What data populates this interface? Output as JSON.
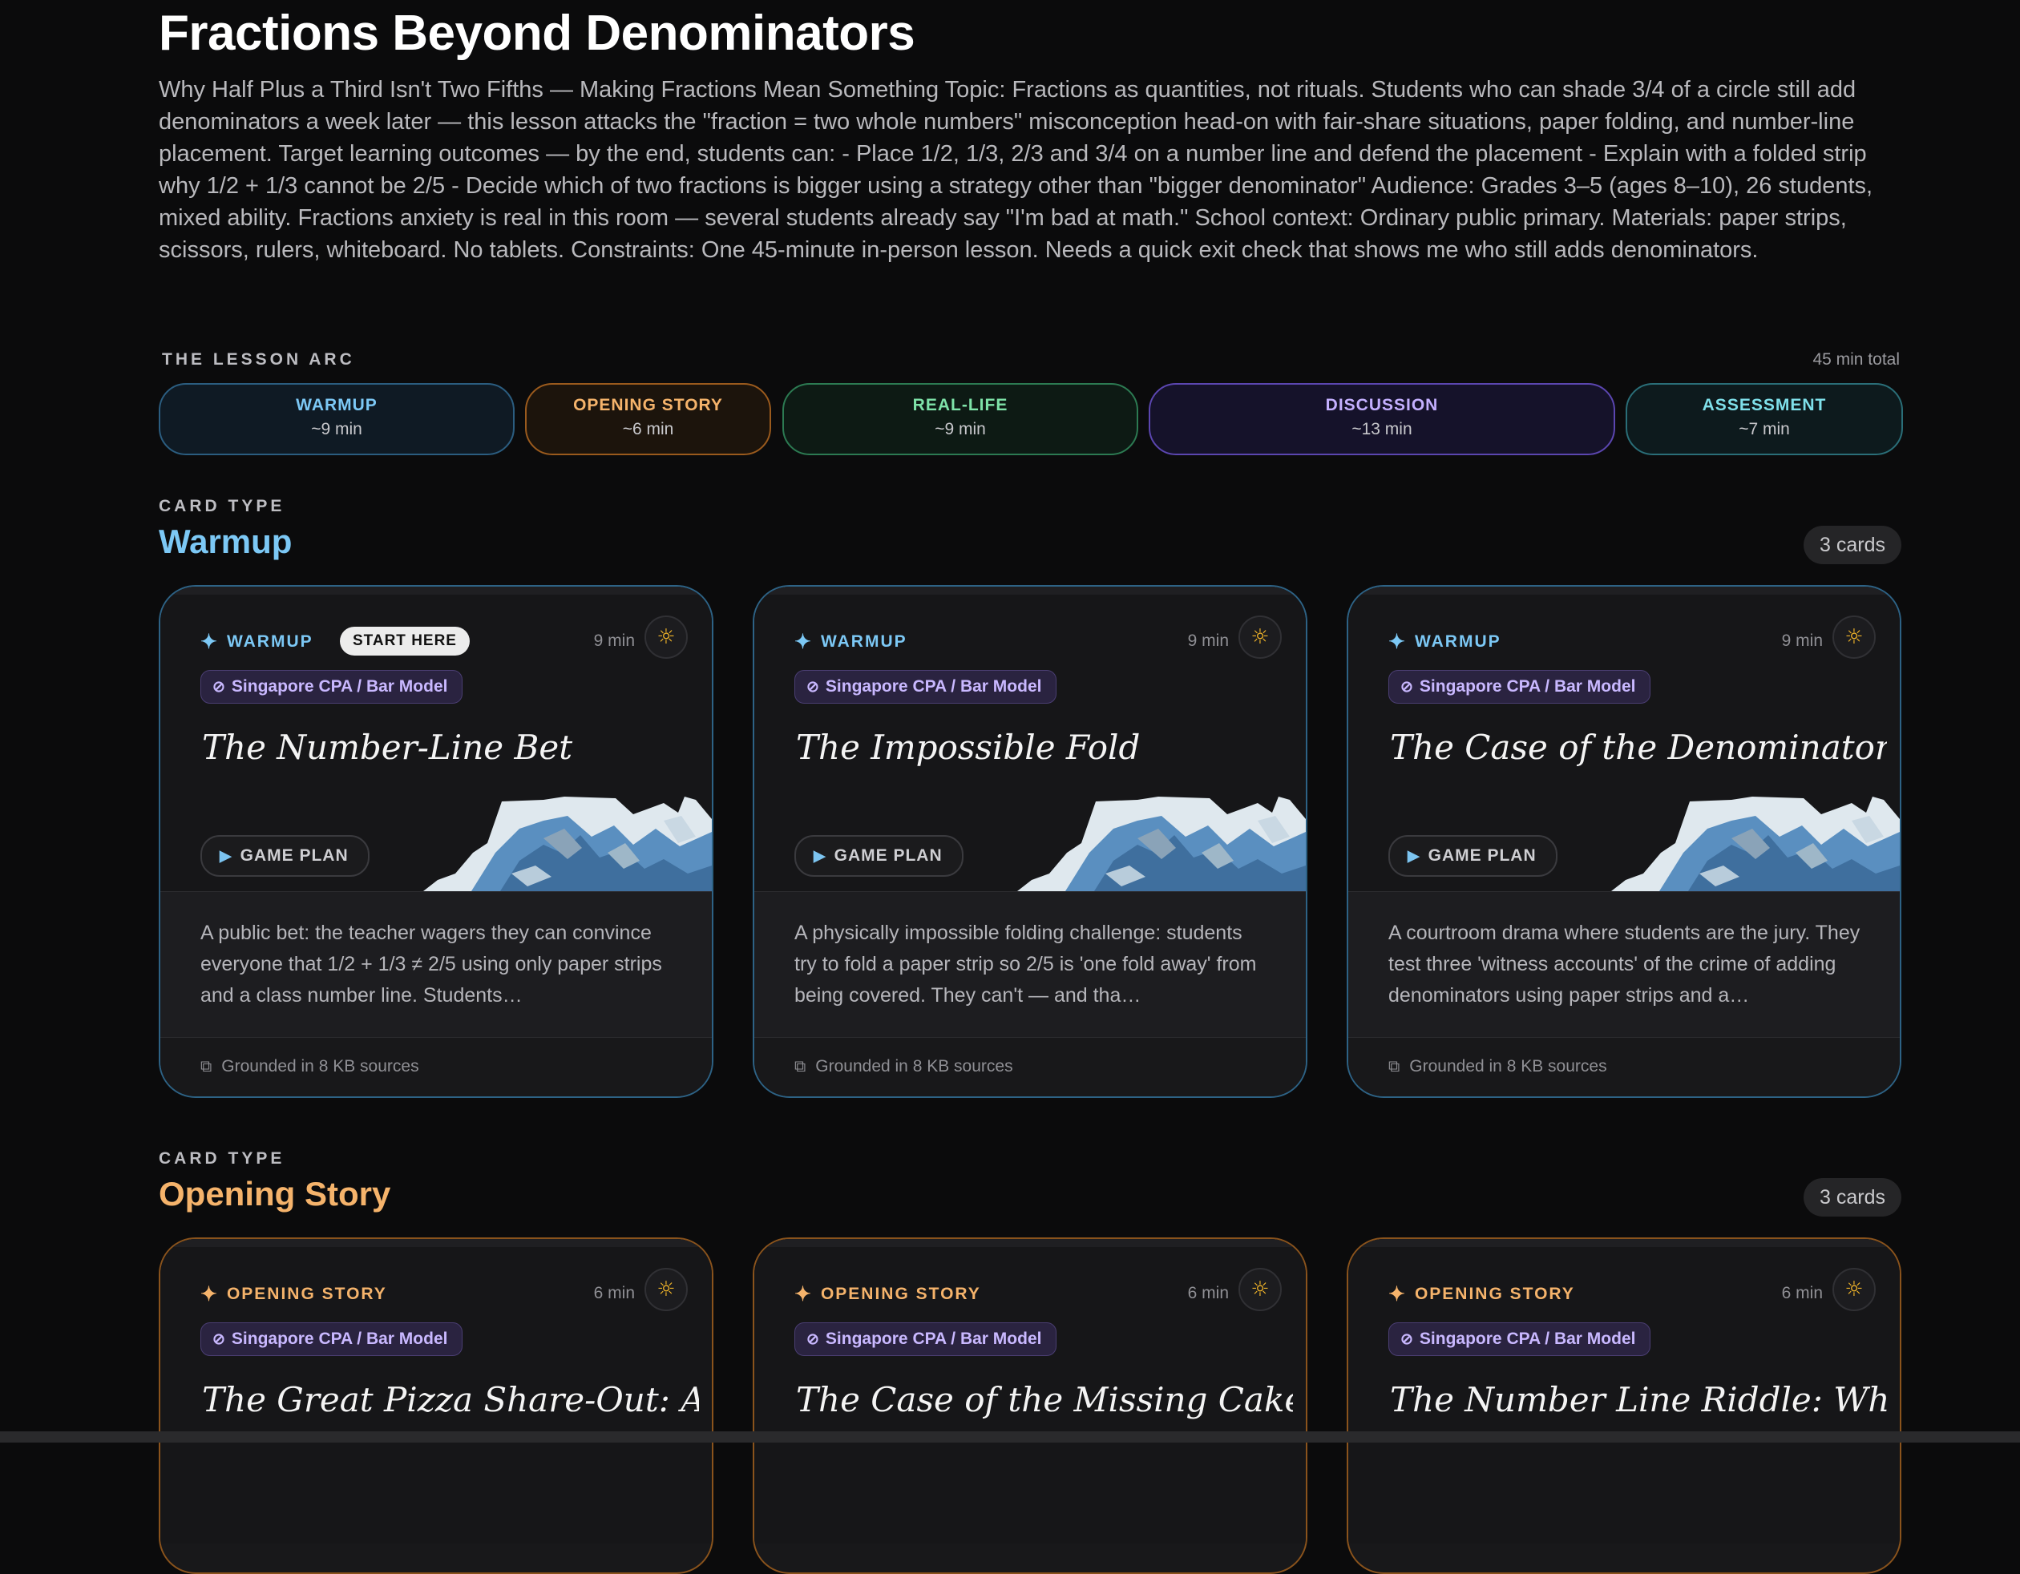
{
  "lesson": {
    "title": "Fractions Beyond Denominators",
    "description": "Why Half Plus a Third Isn't Two Fifths — Making Fractions Mean Something Topic: Fractions as quantities, not rituals. Students who can shade 3/4 of a circle still add denominators a week later — this lesson attacks the \"fraction = two whole numbers\" misconception head-on with fair-share situations, paper folding, and number-line placement. Target learning outcomes — by the end, students can: - Place 1/2, 1/3, 2/3 and 3/4 on a number line and defend the placement - Explain with a folded strip why 1/2 + 1/3 cannot be 2/5 - Decide which of two fractions is bigger using a strategy other than \"bigger denominator\" Audience: Grades 3–5 (ages 8–10), 26 students, mixed ability. Fractions anxiety is real in this room — several students already say \"I'm bad at math.\" School context: Ordinary public primary. Materials: paper strips, scissors, rulers, whiteboard. No tablets. Constraints: One 45-minute in-person lesson. Needs a quick exit check that shows me who still adds denominators."
  },
  "arc": {
    "label": "THE LESSON ARC",
    "total": "45 min total",
    "segments": [
      {
        "name": "WARMUP",
        "duration": "~9 min",
        "color": "#7cc8f5",
        "border": "#2b5d80",
        "bg": "#0f1a24"
      },
      {
        "name": "OPENING STORY",
        "duration": "~6 min",
        "color": "#f5b36b",
        "border": "#9a5a1d",
        "bg": "#1c140c"
      },
      {
        "name": "REAL-LIFE",
        "duration": "~9 min",
        "color": "#7ee2a8",
        "border": "#2c7a52",
        "bg": "#0d1a14"
      },
      {
        "name": "DISCUSSION",
        "duration": "~13 min",
        "color": "#c4b0ff",
        "border": "#5b46b0",
        "bg": "#15122a"
      },
      {
        "name": "ASSESSMENT",
        "duration": "~7 min",
        "color": "#7fe0ea",
        "border": "#2a6e78",
        "bg": "#0d1a1d"
      }
    ]
  },
  "sections": [
    {
      "kicker": "CARD TYPE",
      "title": "Warmup",
      "count": "3 cards",
      "color": "#7cc8f5",
      "cards": [
        {
          "tag": "WARMUP",
          "badge": "START HERE",
          "minutes": "9 min",
          "method": "Singapore CPA / Bar Model",
          "title": "The Number-Line Bet",
          "gameplan": "GAME PLAN",
          "summary": "A public bet: the teacher wagers they can convince everyone that 1/2 + 1/3 ≠ 2/5 using only paper strips and a class number line. Students…",
          "footer": "Grounded in 8 KB sources"
        },
        {
          "tag": "WARMUP",
          "minutes": "9 min",
          "method": "Singapore CPA / Bar Model",
          "title": "The Impossible Fold",
          "gameplan": "GAME PLAN",
          "summary": "A physically impossible folding challenge: students try to fold a paper strip so 2/5 is 'one fold away' from being covered. They can't — and tha…",
          "footer": "Grounded in 8 KB sources"
        },
        {
          "tag": "WARMUP",
          "minutes": "9 min",
          "method": "Singapore CPA / Bar Model",
          "title": "The Case of the Denominator Crime",
          "gameplan": "GAME PLAN",
          "summary": "A courtroom drama where students are the jury. They test three 'witness accounts' of the crime of adding denominators using paper strips and a…",
          "footer": "Grounded in 8 KB sources"
        }
      ]
    },
    {
      "kicker": "CARD TYPE",
      "title": "Opening Story",
      "count": "3 cards",
      "color": "#f5b36b",
      "cards": [
        {
          "tag": "OPENING STORY",
          "minutes": "6 min",
          "method": "Singapore CPA / Bar Model",
          "title": "The Great Pizza Share-Out: A Story"
        },
        {
          "tag": "OPENING STORY",
          "minutes": "6 min",
          "method": "Singapore CPA / Bar Model",
          "title": "The Case of the Missing Cake — A"
        },
        {
          "tag": "OPENING STORY",
          "minutes": "6 min",
          "method": "Singapore CPA / Bar Model",
          "title": "The Number Line Riddle: Where Did"
        }
      ]
    }
  ],
  "icons": {
    "sparkle": "sparkle-icon",
    "lightbulb": "lightbulb-icon",
    "compass": "compass-icon",
    "play": "play-icon",
    "external_link": "external-link-icon"
  }
}
